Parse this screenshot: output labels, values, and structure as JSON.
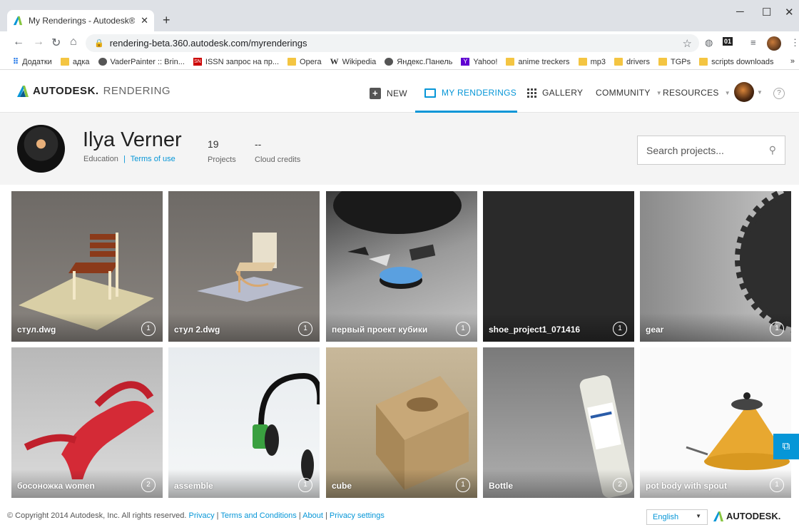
{
  "browser": {
    "tab_title": "My Renderings - Autodesk® Ren",
    "url": "rendering-beta.360.autodesk.com/myrenderings",
    "bookmarks": [
      {
        "label": "Додатки",
        "icon": "apps-icon"
      },
      {
        "label": "адка",
        "icon": "folder-icon"
      },
      {
        "label": "VaderPainter :: Brin...",
        "icon": "globe-icon"
      },
      {
        "label": "ISSN запрос на пр...",
        "icon": "issn-icon"
      },
      {
        "label": "Opera",
        "icon": "folder-icon"
      },
      {
        "label": "Wikipedia",
        "icon": "wikipedia-icon"
      },
      {
        "label": "Яндекс.Панель",
        "icon": "globe-icon"
      },
      {
        "label": "Yahoo!",
        "icon": "yahoo-icon"
      },
      {
        "label": "anime treckers",
        "icon": "folder-icon"
      },
      {
        "label": "mp3",
        "icon": "folder-icon"
      },
      {
        "label": "drivers",
        "icon": "folder-icon"
      },
      {
        "label": "TGPs",
        "icon": "folder-icon"
      },
      {
        "label": "scripts downloads",
        "icon": "folder-icon"
      }
    ],
    "bookmarks_more": "»",
    "extension_01": "01"
  },
  "app": {
    "logo_text": "AUTODESK.",
    "logo_sub": "RENDERING",
    "nav": {
      "new": "NEW",
      "my_renderings": "MY RENDERINGS",
      "gallery": "GALLERY",
      "community": "COMMUNITY",
      "resources": "RESOURCES"
    },
    "help": "?"
  },
  "profile": {
    "name": "Ilya Verner",
    "role": "Education",
    "separator": "|",
    "terms": "Terms of use",
    "projects_value": "19",
    "projects_label": "Projects",
    "credits_value": "--",
    "credits_label": "Cloud credits",
    "search_placeholder": "Search projects..."
  },
  "projects": [
    {
      "label": "стул.dwg",
      "count": "1"
    },
    {
      "label": "стул 2.dwg",
      "count": "1"
    },
    {
      "label": "первый проект кубики",
      "count": "1"
    },
    {
      "label": "shoe_project1_071416",
      "count": "1"
    },
    {
      "label": "gear",
      "count": "1"
    },
    {
      "label": "босоножка women",
      "count": "2"
    },
    {
      "label": "assemble",
      "count": "1"
    },
    {
      "label": "cube",
      "count": "1"
    },
    {
      "label": "Bottle",
      "count": "2"
    },
    {
      "label": "pot body with spout",
      "count": "1"
    }
  ],
  "footer": {
    "copyright": "© Copyright 2014 Autodesk, Inc. All rights reserved.",
    "privacy": "Privacy",
    "terms": "Terms and Conditions",
    "about": "About",
    "privacy_settings": "Privacy settings",
    "sep": "|",
    "language": "English",
    "logo": "AUTODESK."
  },
  "colors": {
    "accent": "#0696d7",
    "profile_bg": "#f4f4f4"
  }
}
